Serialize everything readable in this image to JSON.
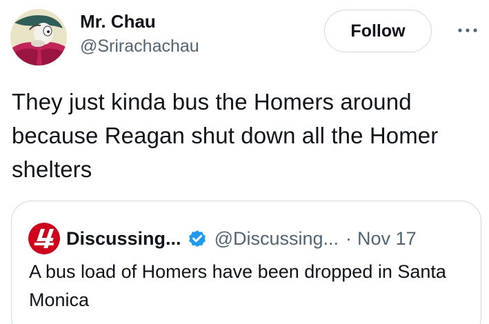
{
  "tweet": {
    "author": {
      "display_name": "Mr. Chau",
      "handle": "@Srirachachau",
      "avatar_icon": "cartoon-avatar-icon"
    },
    "follow_label": "Follow",
    "more_icon": "more-options-icon",
    "text": "They just kinda bus the Homers around because Reagan shut down all the Homer shelters"
  },
  "quote": {
    "author": {
      "display_name": "Discussing...",
      "handle": "@Discussing...",
      "avatar_icon": "discussing-film-logo-icon",
      "verified_icon": "verified-badge-icon"
    },
    "separator": "·",
    "date": "Nov 17",
    "text": "A bus load of Homers have been dropped in Santa Monica"
  },
  "colors": {
    "text_primary": "#0f1419",
    "text_secondary": "#536471",
    "border": "#cfd9de",
    "verified_blue": "#1d9bf0",
    "logo_red": "#d0021b"
  }
}
